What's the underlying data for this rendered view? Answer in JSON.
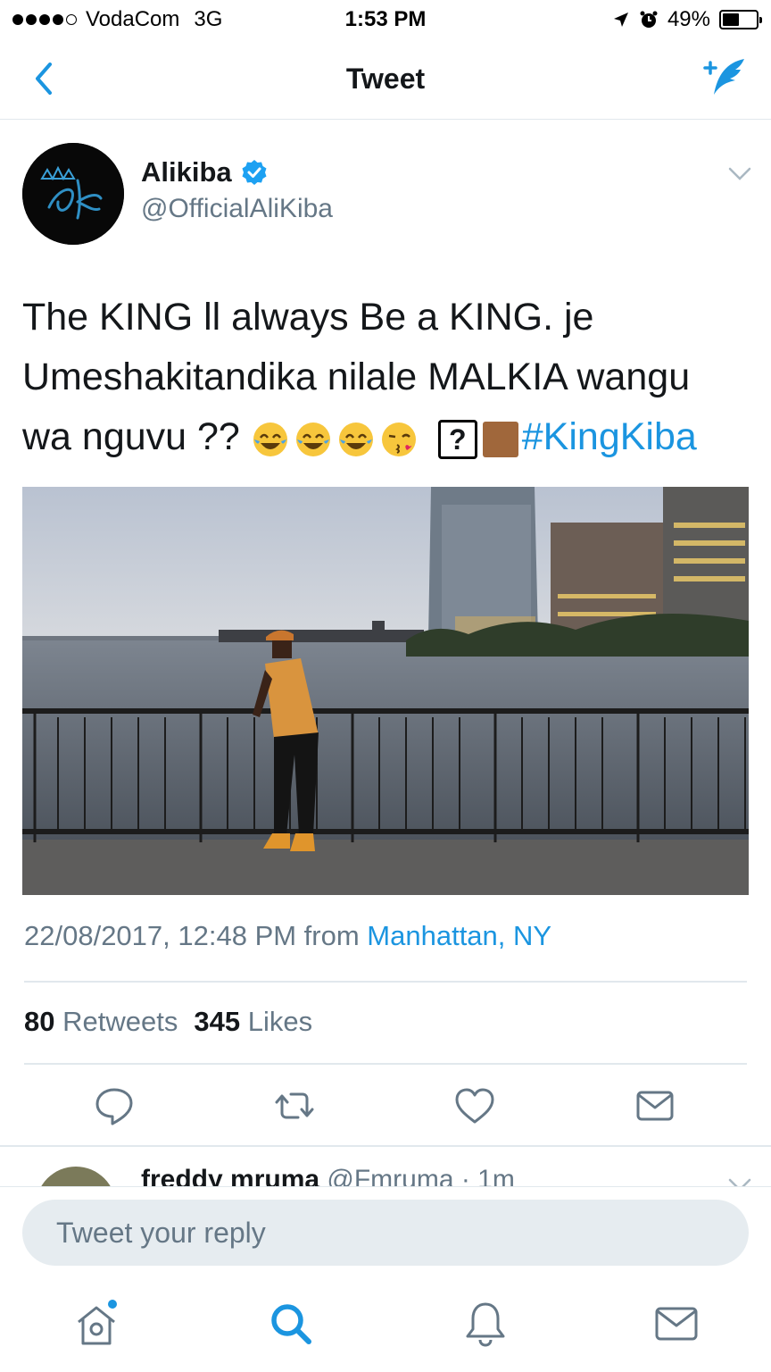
{
  "status_bar": {
    "carrier": "VodaCom",
    "network": "3G",
    "time": "1:53 PM",
    "battery": "49%",
    "battery_level": 0.49
  },
  "nav": {
    "title": "Tweet",
    "back_icon": "chevron-left-icon",
    "compose_icon": "compose-tweet-icon"
  },
  "tweet": {
    "author": {
      "name": "Alikiba",
      "handle": "@OfficialAliKiba",
      "verified": true
    },
    "text_line1": "The KING ll always Be a KING. je",
    "text_line2": "Umeshakitandika nilale MALKIA wangu",
    "text_line3": "wa nguvu ??",
    "unknown_glyph": "?",
    "hashtag": "#KingKiba",
    "timestamp": "22/08/2017, 12:48 PM from ",
    "location": "Manhattan, NY",
    "retweets": "80",
    "retweets_label": "Retweets",
    "likes": "345",
    "likes_label": "Likes"
  },
  "reply_preview": {
    "name": "freddy mruma",
    "handle_time": "@Fmruma · 1m"
  },
  "reply_box": {
    "placeholder": "Tweet your reply"
  },
  "colors": {
    "accent": "#1b95e0",
    "secondary_text": "#657786",
    "divider": "#e1e8ed"
  }
}
